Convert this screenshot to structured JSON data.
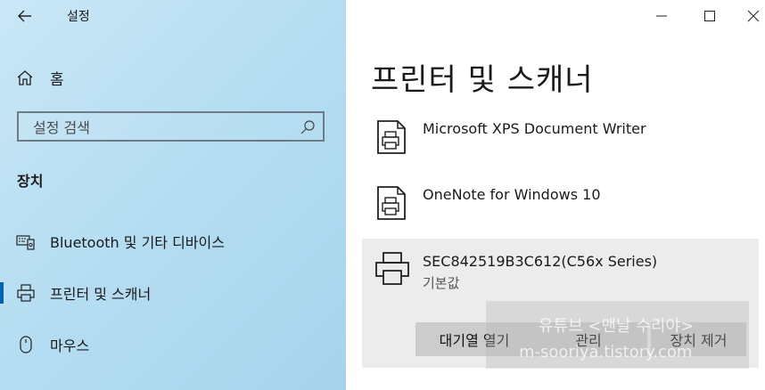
{
  "window": {
    "title": "설정"
  },
  "sidebar": {
    "home_label": "홈",
    "search_placeholder": "설정 검색",
    "section_title": "장치",
    "items": [
      {
        "label": "Bluetooth 및 기타 디바이스",
        "icon": "bluetooth-devices-icon",
        "active": false
      },
      {
        "label": "프린터 및 스캐너",
        "icon": "printer-icon",
        "active": true
      },
      {
        "label": "마우스",
        "icon": "mouse-icon",
        "active": false
      }
    ]
  },
  "main": {
    "title": "프린터 및 스캐너",
    "printers": [
      {
        "name": "Microsoft XPS Document Writer",
        "sub": ""
      },
      {
        "name": "OneNote for Windows 10",
        "sub": ""
      },
      {
        "name": "SEC842519B3C612(C56x Series)",
        "sub": "기본값"
      }
    ],
    "actions": {
      "open_queue": "대기열 열기",
      "manage": "관리",
      "remove": "장치 제거"
    }
  },
  "watermark": {
    "line1": "유튜브 <맨날 수리야>",
    "line2": "m-sooriya.tistory.com"
  },
  "colors": {
    "accent": "#0063b1",
    "selected_bg": "#ececec",
    "button_bg": "#cccccc"
  }
}
